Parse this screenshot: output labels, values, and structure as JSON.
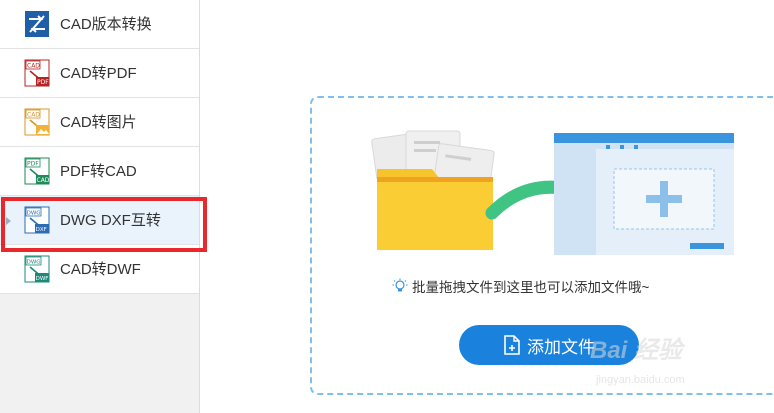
{
  "sidebar": {
    "items": [
      {
        "label": "CAD版本转换",
        "icon": "cad-version-convert-icon",
        "active": false
      },
      {
        "label": "CAD转PDF",
        "icon": "cad-to-pdf-icon",
        "active": false
      },
      {
        "label": "CAD转图片",
        "icon": "cad-to-image-icon",
        "active": false
      },
      {
        "label": "PDF转CAD",
        "icon": "pdf-to-cad-icon",
        "active": false
      },
      {
        "label": "DWG DXF互转",
        "icon": "dwg-dxf-convert-icon",
        "active": true
      },
      {
        "label": "CAD转DWF",
        "icon": "cad-to-dwf-icon",
        "active": false
      }
    ],
    "icon_text": {
      "cad": "CAD",
      "pdf": "PDF",
      "dwg": "DWG",
      "dxf": "DXF",
      "dwf": "DWF"
    }
  },
  "dropzone": {
    "hint": "批量拖拽文件到这里也可以添加文件哦~",
    "add_button_label": "添加文件"
  },
  "watermark": {
    "main": "Bai 经验",
    "sub": "jingyan.baidu.com"
  },
  "colors": {
    "accent": "#1a82dc",
    "highlight": "#e8282b",
    "dashed_border": "#7fbfea",
    "arrow": "#3fc483",
    "folder": "#f7c52b"
  }
}
